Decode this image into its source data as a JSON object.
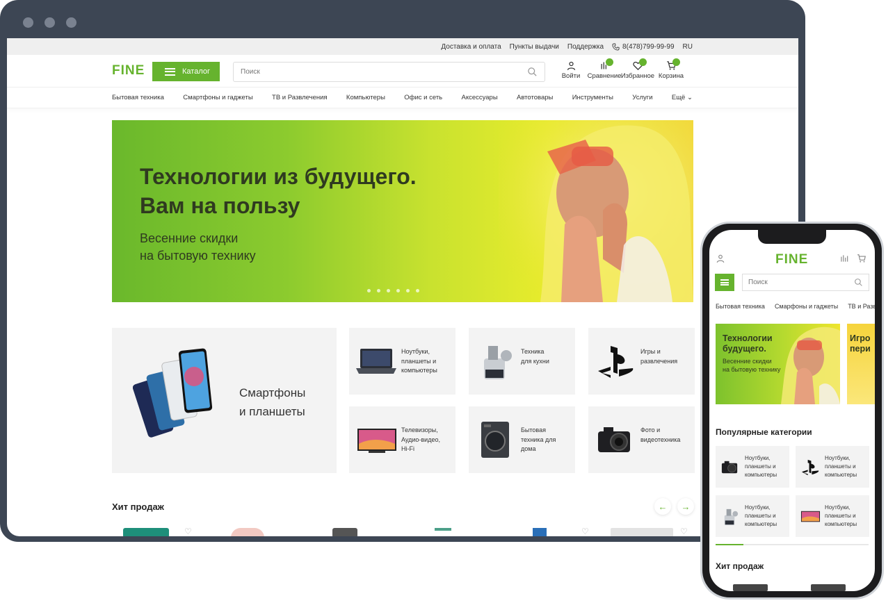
{
  "desktop": {
    "topbar": {
      "links": [
        "Доставка и оплата",
        "Пункты выдачи",
        "Поддержка"
      ],
      "phone": "8(478)799-99-99",
      "lang": "RU"
    },
    "header": {
      "logo": "FINE",
      "catalog_label": "Каталог",
      "search_placeholder": "Поиск",
      "icons": [
        {
          "label": "Войти",
          "icon": "user-icon"
        },
        {
          "label": "Сравнение",
          "icon": "compare-icon"
        },
        {
          "label": "Избранное",
          "icon": "heart-icon"
        },
        {
          "label": "Корзина",
          "icon": "cart-icon"
        }
      ]
    },
    "nav": [
      "Бытовая техника",
      "Смартфоны и гаджеты",
      "ТВ и Развлечения",
      "Компьютеры",
      "Офис и сеть",
      "Аксессуары",
      "Автотовары",
      "Инструменты",
      "Услуги",
      "Ещё"
    ],
    "banner": {
      "title_line1": "Технологии из будущего.",
      "title_line2": "Вам на пользу",
      "sub_line1": "Весенние скидки",
      "sub_line2": "на бытовую технику"
    },
    "categories": {
      "big_line1": "Смартфоны",
      "big_line2": "и планшеты",
      "tiles": [
        {
          "line1": "Ноутбуки,",
          "line2": "планшеты и",
          "line3": "компьютеры",
          "icon": "laptop-icon"
        },
        {
          "line1": "Техника",
          "line2": "для кухни",
          "line3": "",
          "icon": "meat-grinder-icon"
        },
        {
          "line1": "Игры и",
          "line2": "развлечения",
          "line3": "",
          "icon": "playstation-icon"
        },
        {
          "line1": "Телевизоры,",
          "line2": "Аудио-видео,",
          "line3": "Hi-Fi",
          "icon": "tv-icon"
        },
        {
          "line1": "Бытовая",
          "line2": "техника для",
          "line3": "дома",
          "icon": "washing-machine-icon"
        },
        {
          "line1": "Фото и",
          "line2": "видеотехника",
          "line3": "",
          "icon": "camera-icon"
        }
      ]
    },
    "hits_title": "Хит продаж"
  },
  "mobile": {
    "logo": "FINE",
    "search_placeholder": "Поиск",
    "nav": [
      "Бытовая техника",
      "Смарфоны и гаджеты",
      "ТВ и Развле"
    ],
    "banner": {
      "title_line1": "Технологии",
      "title_line2": "будущего.",
      "sub_line1": "Весенние скидки",
      "sub_line2": "на бытовую технику"
    },
    "banner2": {
      "title_line1": "Игро",
      "title_line2": "пери"
    },
    "popular_title": "Популярные категории",
    "tiles": [
      {
        "line1": "Ноутбуки,",
        "line2": "планшеты и",
        "line3": "компьютеры",
        "icon": "camera-icon"
      },
      {
        "line1": "Ноутбуки,",
        "line2": "планшеты и",
        "line3": "компьютеры",
        "icon": "playstation-icon"
      },
      {
        "line1": "Ноутбуки,",
        "line2": "планшеты и",
        "line3": "компьютеры",
        "icon": "meat-grinder-icon"
      },
      {
        "line1": "Ноутбуки,",
        "line2": "планшеты и",
        "line3": "компьютеры",
        "icon": "tv-icon"
      }
    ],
    "hits_title": "Хит продаж"
  },
  "colors": {
    "brand_green": "#66b32e",
    "frame": "#3d4654"
  }
}
